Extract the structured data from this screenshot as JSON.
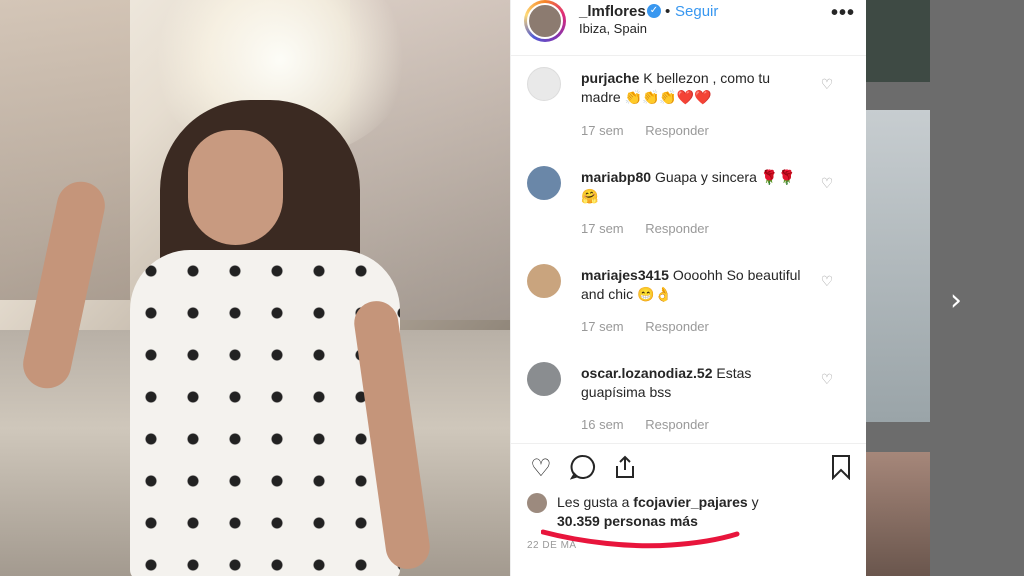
{
  "post": {
    "username": "_lmflores",
    "follow_label": "Seguir",
    "separator": "•",
    "location": "Ibiza, Spain",
    "more_label": "•••"
  },
  "comments": [
    {
      "user": "purjache",
      "text": "K bellezon , como tu madre 👏👏👏❤️❤️",
      "time": "17 sem",
      "reply": "Responder",
      "avatar_color": "#e9e9e9"
    },
    {
      "user": "mariabp80",
      "text": "Guapa y sincera 🌹🌹🤗",
      "time": "17 sem",
      "reply": "Responder",
      "avatar_color": "#6a87a8"
    },
    {
      "user": "mariajes3415",
      "text": "Oooohh So beautiful and chic 😁👌",
      "time": "17 sem",
      "reply": "Responder",
      "avatar_color": "#c9a47e"
    },
    {
      "user": "oscar.lozanodiaz.52",
      "text": "Estas guapísima bss",
      "time": "16 sem",
      "reply": "Responder",
      "avatar_color": "#8a8d90"
    }
  ],
  "likes": {
    "prefix": "Les gusta a",
    "first_user": "fcojavier_pajares",
    "conj": "y",
    "count": "30.359 personas más"
  },
  "date": "22 DE MA",
  "icons": {
    "verified": "verified-badge-icon",
    "heart": "heart-icon",
    "comment": "comment-icon",
    "share": "share-icon",
    "save": "bookmark-icon",
    "next": "chevron-right-icon"
  },
  "colors": {
    "accent": "#3897f0",
    "annotation": "#e8153c"
  }
}
